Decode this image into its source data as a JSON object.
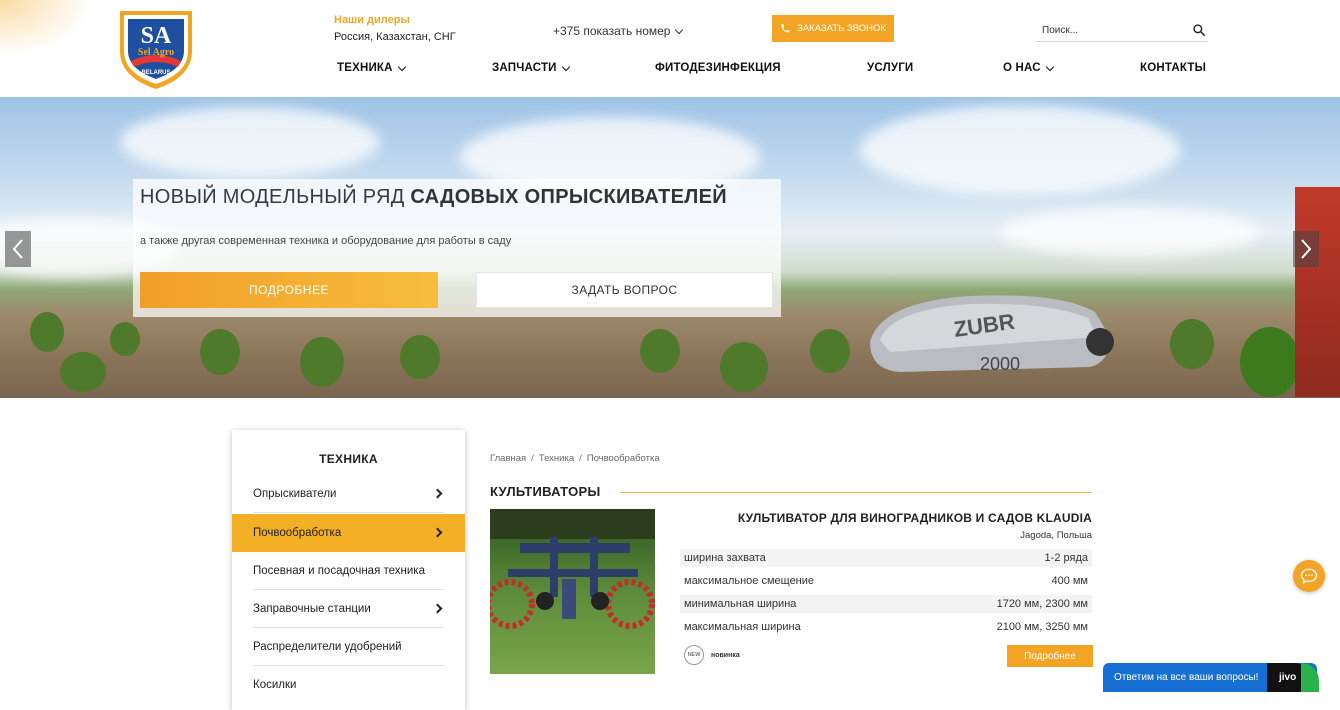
{
  "header": {
    "logo_text_main": "SA",
    "logo_text_sub": "Sel Agro",
    "logo_text_country": "BELARUS",
    "dealers_title": "Наши дилеры",
    "dealers_regions": "Россия, Казахстан, СНГ",
    "phone_label": "+375 показать номер",
    "call_button": "ЗАКАЗАТЬ ЗВОНОК",
    "search_placeholder": "Поиск...",
    "nav": [
      {
        "label": "ТЕХНИКА",
        "has_dropdown": true
      },
      {
        "label": "ЗАПЧАСТИ",
        "has_dropdown": true
      },
      {
        "label": "ФИТОДЕЗИНФЕКЦИЯ",
        "has_dropdown": false
      },
      {
        "label": "УСЛУГИ",
        "has_dropdown": false
      },
      {
        "label": "О НАС",
        "has_dropdown": true
      },
      {
        "label": "КОНТАКТЫ",
        "has_dropdown": false
      }
    ]
  },
  "hero": {
    "title_light": "НОВЫЙ МОДЕЛЬНЫЙ РЯД ",
    "title_bold": "САДОВЫХ ОПРЫСКИВАТЕЛЕЙ",
    "subtitle": "а также другая современная техника и оборудование для работы в саду",
    "btn_more": "ПОДРОБНЕЕ",
    "btn_ask": "ЗАДАТЬ ВОПРОС",
    "machine_brand": "ZUBR",
    "machine_model": "2000"
  },
  "sidebar": {
    "title": "ТЕХНИКА",
    "items": [
      {
        "label": "Опрыскиватели",
        "has_arrow": true,
        "active": false
      },
      {
        "label": "Почвообработка",
        "has_arrow": true,
        "active": true
      },
      {
        "label": "Посевная и посадочная техника",
        "has_arrow": false,
        "active": false
      },
      {
        "label": "Заправочные станции",
        "has_arrow": true,
        "active": false
      },
      {
        "label": "Распределители удобрений",
        "has_arrow": false,
        "active": false
      },
      {
        "label": "Косилки",
        "has_arrow": false,
        "active": false
      }
    ]
  },
  "breadcrumb": [
    "Главная",
    "Техника",
    "Почвообработка"
  ],
  "breadcrumb_sep": "/",
  "section_title": "КУЛЬТИВАТОРЫ",
  "product": {
    "title": "КУЛЬТИВАТОР ДЛЯ ВИНОГРАДНИКОВ И САДОВ KLAUDIA",
    "maker": "Jagoda, Польша",
    "specs": [
      {
        "name": "ширина захвата",
        "value": "1-2 ряда"
      },
      {
        "name": "максимальное смещение",
        "value": "400 мм"
      },
      {
        "name": "минимальная ширина",
        "value": "1720 мм, 2300 мм"
      },
      {
        "name": "максимальная ширина",
        "value": "2100 мм, 3250 мм"
      }
    ],
    "badge_icon_text": "NEW",
    "badge_label": "новинка",
    "more_button": "Подробнее"
  },
  "chat": {
    "jivo_text": "Ответим на все ваши вопросы!",
    "jivo_brand": "jivo"
  },
  "colors": {
    "accent": "#f4a424",
    "sidebar_active": "#f4b024",
    "jivo_blue": "#1670d4"
  }
}
